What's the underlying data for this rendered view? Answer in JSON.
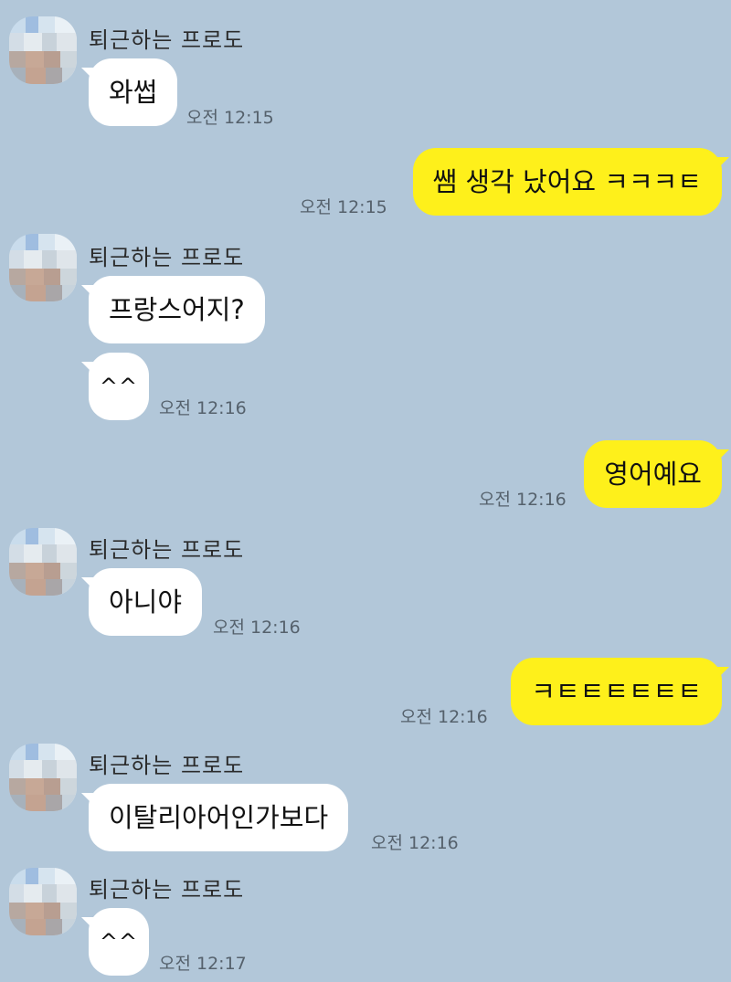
{
  "chat": {
    "messages": [
      {
        "sender": "퇴근하는 프로도",
        "text": "와썹",
        "time": "오전 12:15",
        "direction": "in"
      },
      {
        "text": "쌤 생각 났어요 ㅋㅋㅋㅌ",
        "time": "오전 12:15",
        "direction": "out"
      },
      {
        "sender": "퇴근하는 프로도",
        "text": "프랑스어지?",
        "direction": "in"
      },
      {
        "text": "^^",
        "time": "오전 12:16",
        "direction": "in"
      },
      {
        "text": "영어예요",
        "time": "오전 12:16",
        "direction": "out"
      },
      {
        "sender": "퇴근하는 프로도",
        "text": "아니야",
        "time": "오전 12:16",
        "direction": "in"
      },
      {
        "text": "ㅋㅌㅌㅌㅌㅌㅌ",
        "time": "오전 12:16",
        "direction": "out"
      },
      {
        "sender": "퇴근하는 프로도",
        "text": "이탈리아어인가보다",
        "time": "오전 12:16",
        "direction": "in"
      },
      {
        "sender": "퇴근하는 프로도",
        "text": "^^",
        "time": "오전 12:17",
        "direction": "in"
      }
    ]
  },
  "colors": {
    "background": "#b2c7d9",
    "incoming_bubble": "#ffffff",
    "outgoing_bubble": "#fef01b"
  }
}
